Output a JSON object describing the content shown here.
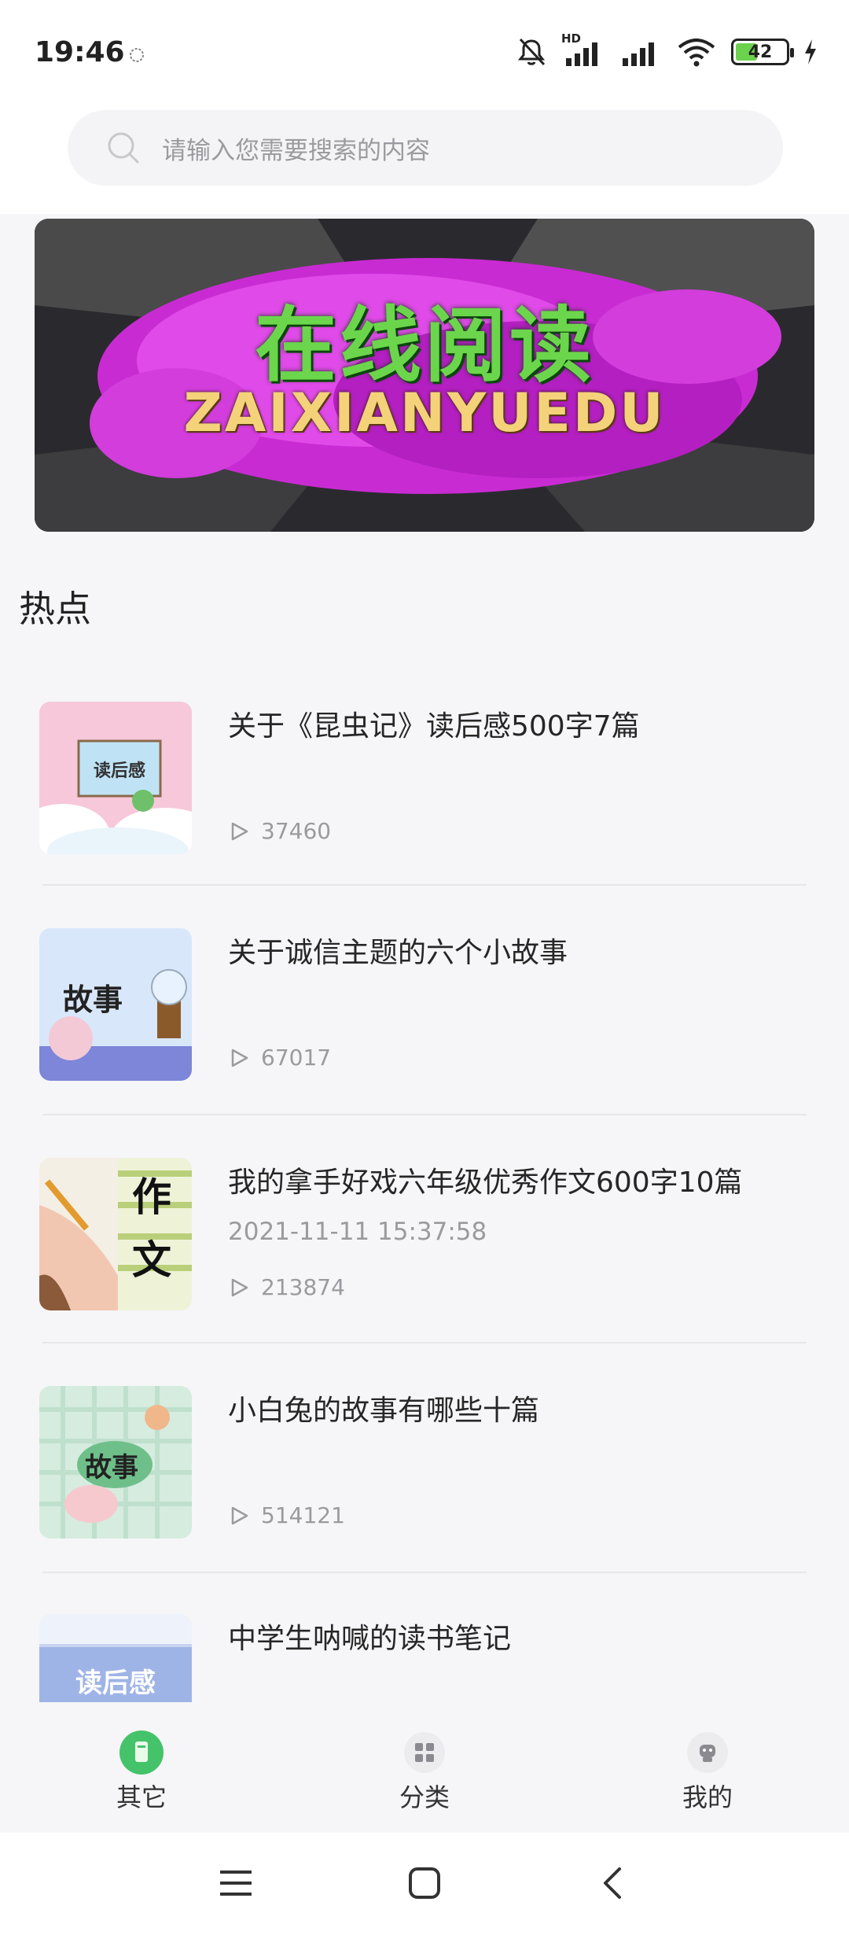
{
  "status_bar": {
    "time": "19:46",
    "network_label": "HD",
    "battery": "42"
  },
  "search": {
    "placeholder": "请输入您需要搜索的内容"
  },
  "banner": {
    "title": "在线阅读",
    "subtitle": "ZAIXIANYUEDU"
  },
  "section": {
    "title": "热点"
  },
  "articles": [
    {
      "title": "关于《昆虫记》读后感500字7篇",
      "date": "",
      "views": "37460",
      "thumb_text": "读后感"
    },
    {
      "title": "关于诚信主题的六个小故事",
      "date": "",
      "views": "67017",
      "thumb_text": "故事"
    },
    {
      "title": "我的拿手好戏六年级优秀作文600字10篇",
      "date": "2021-11-11 15:37:58",
      "views": "213874",
      "thumb_text": "作文"
    },
    {
      "title": "小白兔的故事有哪些十篇",
      "date": "",
      "views": "514121",
      "thumb_text": "故事"
    },
    {
      "title": "中学生呐喊的读书笔记",
      "date": "",
      "views": "",
      "thumb_text": "读后感"
    }
  ],
  "tabs": [
    {
      "label": "其它",
      "icon": "book-icon",
      "active": true
    },
    {
      "label": "分类",
      "icon": "grid-icon",
      "active": false
    },
    {
      "label": "我的",
      "icon": "robot-icon",
      "active": false
    }
  ],
  "colors": {
    "accent": "#45c36a",
    "muted": "#9a9a9f"
  }
}
